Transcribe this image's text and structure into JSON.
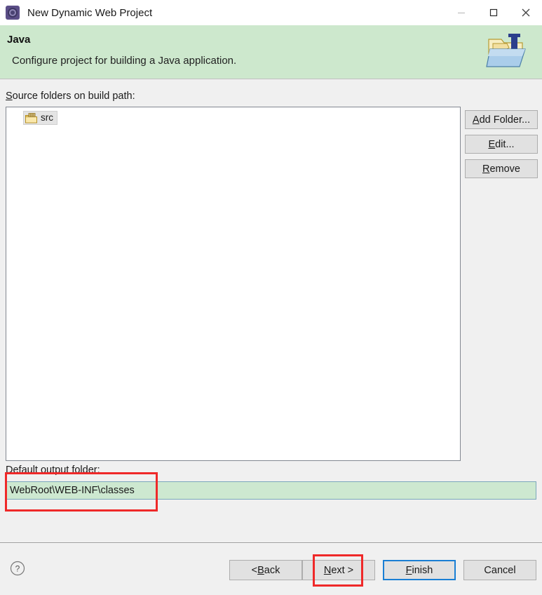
{
  "window": {
    "title": "New Dynamic Web Project",
    "icon": "eclipse-wizard-icon",
    "controls": {
      "minimize": "minimize-icon",
      "maximize": "maximize-icon",
      "close": "close-icon"
    }
  },
  "header": {
    "title": "Java",
    "description": "Configure project for building a Java application.",
    "icon": "java-build-path-folder-icon",
    "background_color": "#cde8cd"
  },
  "body": {
    "source_label_mnemonic": "S",
    "source_label_rest": "ource folders on build path:",
    "tree": {
      "items": [
        {
          "label": "src",
          "icon": "source-package-folder-icon",
          "selected": true
        }
      ]
    },
    "side_buttons": [
      {
        "id": "add-folder",
        "mnemonic": "A",
        "before": "",
        "after": "dd Folder..."
      },
      {
        "id": "edit",
        "mnemonic": "E",
        "before": "",
        "after": "dit..."
      },
      {
        "id": "remove",
        "mnemonic": "R",
        "before": "",
        "after": "emove"
      }
    ],
    "output_label_mnemonic": "D",
    "output_label_rest": "efault output folder:",
    "output_value": "WebRoot\\WEB-INF\\classes",
    "output_placeholder": "",
    "output_field_color": "#cde8d0"
  },
  "footer": {
    "help_icon": "help-question-icon",
    "buttons": [
      {
        "id": "back",
        "before": "< ",
        "mnemonic": "B",
        "after": "ack",
        "focused": false
      },
      {
        "id": "next",
        "before": "",
        "mnemonic": "N",
        "after": "ext >",
        "focused": false
      },
      {
        "id": "finish",
        "before": "",
        "mnemonic": "F",
        "after": "inish",
        "focused": true
      },
      {
        "id": "cancel",
        "before": "Cancel",
        "mnemonic": "",
        "after": "",
        "focused": false
      }
    ]
  },
  "annotations": {
    "color": "#ef2929",
    "boxes": [
      {
        "id": "output-field-highlight",
        "target": "default-output-folder-input"
      },
      {
        "id": "next-button-highlight",
        "target": "next-button"
      }
    ]
  }
}
